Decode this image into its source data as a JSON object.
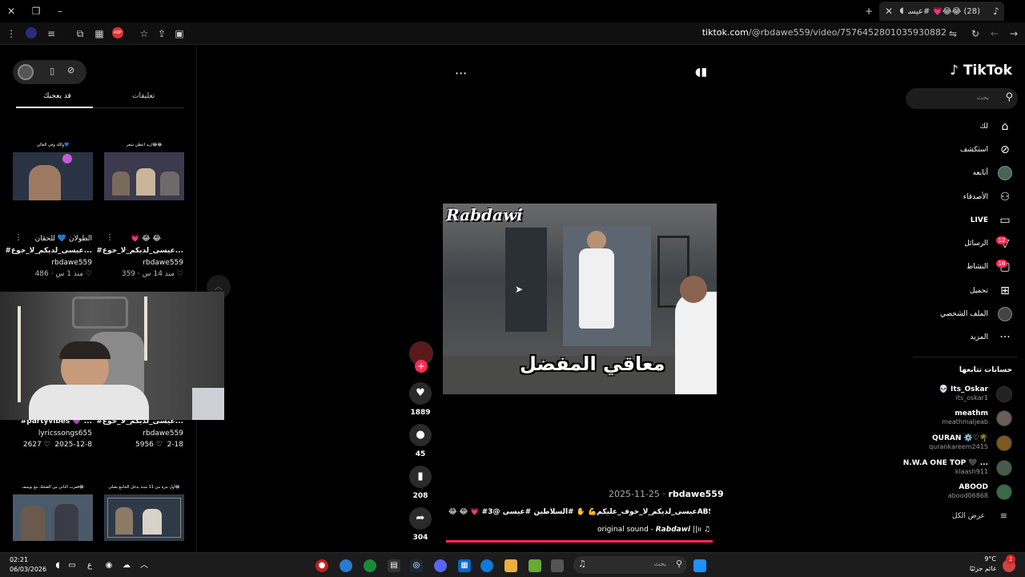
{
  "browser": {
    "tab_title": "(28) 😂😂💗 #عيسى_لديكم",
    "url_domain": "tiktok.com",
    "url_path": "/@rbdawe559/video/7576452801035930882",
    "abp_label": "ABP"
  },
  "left_panel": {
    "tab_you_may_like": "قد يعجبك",
    "tab_comments": "تعليقات",
    "videos": [
      {
        "caption": "اريد اعطي شعر😂😂",
        "title": "💗 😂 😂",
        "tag": "#عيسى_لديكم_لا_خوع...",
        "author": "rbdawe559",
        "time": "منذ 14 س",
        "likes": "359"
      },
      {
        "caption": "والله وفي العالي💙",
        "title": "الطولان 💙 للحقان",
        "tag": "#عيسى_لديكم_لا_خوع...",
        "author": "rbdawe559",
        "time": "منذ 1 س",
        "likes": "486"
      },
      {
        "title": "#عيسى_لديكم_لا_خوع...",
        "author": "rbdawe559",
        "time": "2-18",
        "likes": "5956"
      },
      {
        "title": "#partyvibes 💜 ...",
        "author": "lyricssongs655",
        "time": "2025-12-8",
        "likes": "2627"
      },
      {
        "caption": "أول مرة من 11 سنة يدخل الجامع يصلي😂",
        "title": ""
      },
      {
        "caption": "قفزت الثاني من الضحك مع يوسف😂",
        "title": ""
      }
    ]
  },
  "video": {
    "watermark": "Rabdawi",
    "overlay_text": "معاقي المفضل",
    "author": "rbdawe559",
    "date": "2025-11-25",
    "description": "😂 😂 💗 #عيسى_لديكم_لا_خوف_عليكم💪 ✋ #السلاطين #عيسى @3ABSI",
    "sound": "original sound - 𝙍𝙖𝙗𝙙𝙖𝙬𝙞 ||ıı",
    "likes": "1889",
    "comments": "45",
    "saves": "208",
    "shares": "304"
  },
  "sidebar": {
    "logo": "TikTok",
    "search_placeholder": "بحث",
    "nav": [
      {
        "label": "لك",
        "icon": "home-icon"
      },
      {
        "label": "استكشف",
        "icon": "compass-icon"
      },
      {
        "label": "أتابعه",
        "icon": "following-icon"
      },
      {
        "label": "الأصدقاء",
        "icon": "friends-icon"
      },
      {
        "label": "LIVE",
        "icon": "live-icon"
      },
      {
        "label": "الرسائل",
        "icon": "messages-icon",
        "badge": "12"
      },
      {
        "label": "النشاط",
        "icon": "activity-icon",
        "badge": "16"
      },
      {
        "label": "تحميل",
        "icon": "upload-icon"
      },
      {
        "label": "الملف الشخصي",
        "icon": "profile-icon"
      },
      {
        "label": "المزيد",
        "icon": "more-icon"
      }
    ],
    "following_title": "حسابات تتابعها",
    "accounts": [
      {
        "name": "💀 Its_Oskar",
        "handle": "its_oskar1"
      },
      {
        "name": "meathm",
        "handle": "meathmaljeab"
      },
      {
        "name": "QURAN ⚙️♡🌴",
        "handle": "qurankareem2415"
      },
      {
        "name": "N.W.A ONE TOP 🖤 ...",
        "handle": "klaash911"
      },
      {
        "name": "ABOOD",
        "handle": "abood06868"
      }
    ],
    "show_all": "عرض الكل"
  },
  "taskbar": {
    "time": "02:21",
    "date": "06/03/2026",
    "search_placeholder": "بحث",
    "weather_temp": "9°C",
    "weather_desc": "غائم جزئيًا",
    "lang": "ع",
    "notif_count": "2"
  }
}
